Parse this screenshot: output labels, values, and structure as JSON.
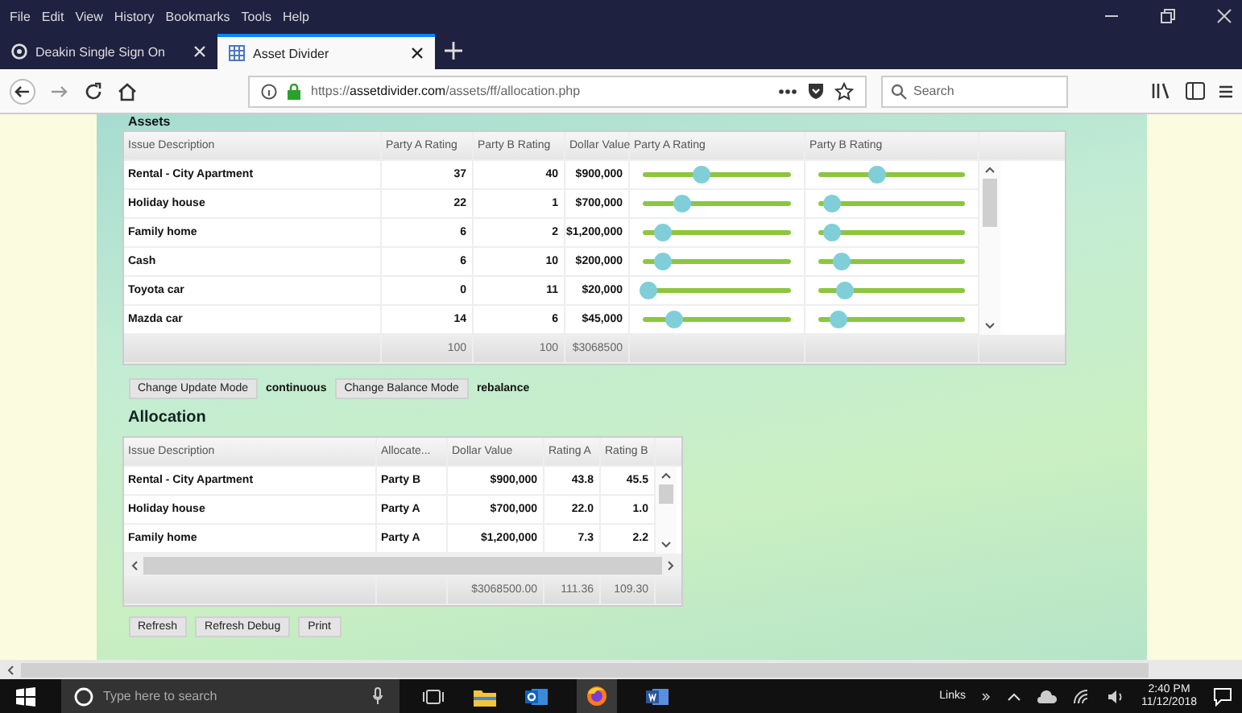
{
  "menu": [
    "File",
    "Edit",
    "View",
    "History",
    "Bookmarks",
    "Tools",
    "Help"
  ],
  "tabs": [
    {
      "title": "Deakin Single Sign On",
      "selected": false
    },
    {
      "title": "Asset Divider",
      "selected": true
    }
  ],
  "address": {
    "scheme": "https://",
    "domain": "assetdivider.com",
    "path": "/assets/ff/allocation.php"
  },
  "search": {
    "placeholder": "Search"
  },
  "assets": {
    "title": "Assets",
    "columns": [
      "Issue Description",
      "Party A Rating",
      "Party B Rating",
      "Dollar Value",
      "Party A Rating",
      "Party B Rating"
    ],
    "rows": [
      {
        "description": "Rental - City Apartment",
        "a": "37",
        "b": "40",
        "value": "$900,000",
        "a_slider": {
          "level": 0.39
        },
        "b_slider": {
          "level": 0.4
        }
      },
      {
        "description": "Holiday house",
        "a": "22",
        "b": "1",
        "value": "$700,000",
        "a_slider": {
          "level": 0.25
        },
        "b_slider": {
          "level": 0.06
        }
      },
      {
        "description": "Family home",
        "a": "6",
        "b": "2",
        "value": "$1,200,000",
        "a_slider": {
          "level": 0.11
        },
        "b_slider": {
          "level": 0.07
        }
      },
      {
        "description": "Cash",
        "a": "6",
        "b": "10",
        "value": "$200,000",
        "a_slider": {
          "level": 0.11
        },
        "b_slider": {
          "level": 0.14
        }
      },
      {
        "description": "Toyota car",
        "a": "0",
        "b": "11",
        "value": "$20,000",
        "a_slider": {
          "level": 0.0
        },
        "b_slider": {
          "level": 0.16
        }
      },
      {
        "description": "Mazda car",
        "a": "14",
        "b": "6",
        "value": "$45,000",
        "a_slider": {
          "level": 0.19
        },
        "b_slider": {
          "level": 0.11
        }
      }
    ],
    "totals": [
      "100",
      "100",
      "$3068500"
    ]
  },
  "modes": [
    {
      "button": "Change Update Mode",
      "value": "continuous"
    },
    {
      "button": "Change Balance Mode",
      "value": "rebalance"
    }
  ],
  "allocation": {
    "title": "Allocation",
    "columns": [
      "Issue Description",
      "Allocate...",
      "Dollar Value",
      "Rating A",
      "Rating B"
    ],
    "rows": [
      {
        "description": "Rental - City Apartment",
        "party": "Party B",
        "value": "$900,000",
        "a": "43.8",
        "b": "45.5"
      },
      {
        "description": "Holiday house",
        "party": "Party A",
        "value": "$700,000",
        "a": "22.0",
        "b": "1.0"
      },
      {
        "description": "Family home",
        "party": "Party A",
        "value": "$1,200,000",
        "a": "7.3",
        "b": "2.2"
      }
    ],
    "totals": [
      "$3068500.00",
      "111.36",
      "109.30"
    ]
  },
  "buttons": [
    "Refresh",
    "Refresh Debug",
    "Print"
  ],
  "taskbar": {
    "search_placeholder": "Type here to search",
    "links": "Links",
    "time": "2:40 PM",
    "date": "11/12/2018"
  }
}
